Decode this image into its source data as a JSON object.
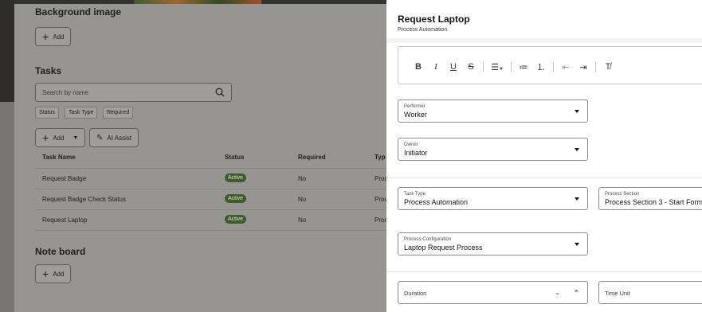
{
  "left": {
    "background_section": {
      "title": "Background image",
      "add_label": "Add"
    },
    "tasks_section": {
      "title": "Tasks",
      "search_placeholder": "Search by name",
      "filters": [
        "Status",
        "Task Type",
        "Required"
      ],
      "add_label": "Add",
      "ai_assist_label": "AI Assist",
      "columns": [
        "Task Name",
        "Status",
        "Required",
        "Typ"
      ],
      "rows": [
        {
          "name": "Request Badge",
          "status": "Active",
          "required": "No",
          "type": "Proc"
        },
        {
          "name": "Request Badge Check Status",
          "status": "Active",
          "required": "No",
          "type": "Proc"
        },
        {
          "name": "Request Laptop",
          "status": "Active",
          "required": "No",
          "type": "Proc"
        }
      ]
    },
    "note_section": {
      "title": "Note board",
      "add_label": "Add"
    }
  },
  "drawer": {
    "title": "Request Laptop",
    "subtitle": "Process Automation",
    "toolbar_icons": [
      "bold-icon",
      "italic-icon",
      "underline-icon",
      "strikethrough-icon",
      "align-icon",
      "bullet-list-icon",
      "numbered-list-icon",
      "outdent-icon",
      "indent-icon",
      "clear-format-icon"
    ],
    "fields": {
      "performer": {
        "label": "Performer",
        "value": "Worker"
      },
      "owner": {
        "label": "Owner",
        "value": "Initiator"
      },
      "task_type": {
        "label": "Task Type",
        "value": "Process Automation"
      },
      "process_section": {
        "label": "Process Section",
        "value": "Process Section 3 - Start Form"
      },
      "process_configuration": {
        "label": "Process Configuration",
        "value": "Laptop Request Process"
      },
      "duration": {
        "label": "Duration",
        "value": ""
      },
      "time_unit": {
        "label": "Time Unit",
        "value": ""
      }
    }
  },
  "colors": {
    "badge_bg": "#3f5b2d",
    "overlay": "#969592",
    "drawer_bg": "#ffffff"
  }
}
